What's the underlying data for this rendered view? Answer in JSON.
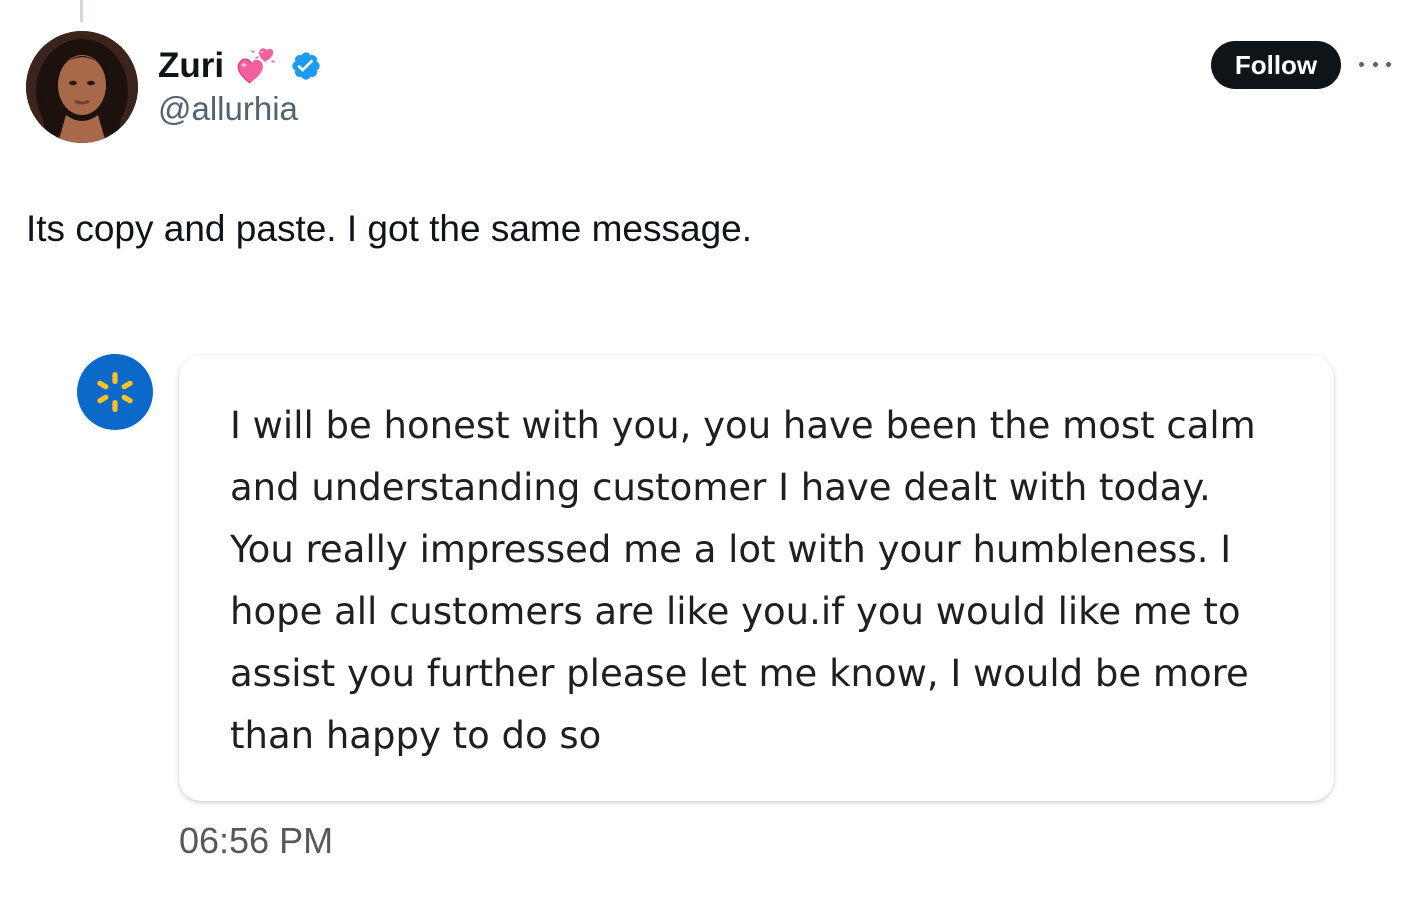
{
  "tweet": {
    "display_name": "Zuri",
    "handle": "@allurhia",
    "follow_label": "Follow",
    "text": "Its copy and paste. I got the same message.",
    "colors": {
      "follow_bg": "#0f1419",
      "verified": "#1d9bf0",
      "handle": "#536471"
    },
    "icons": {
      "name_emoji": "two-hearts-icon",
      "verified": "verified-badge-icon",
      "more": "more-options-icon"
    }
  },
  "chat": {
    "logo": "walmart-spark-logo",
    "logo_color": "#0b6ac9",
    "spark_color": "#ffc220",
    "message_lines": [
      "I will be honest with you, you have been the most calm",
      "and understanding customer I have dealt with today.",
      "You really impressed me a lot with your humbleness. I",
      "hope all customers are like you.if you would like me to",
      "assist you further please let me know, I would be more",
      "than happy to do so"
    ],
    "timestamp": "06:56 PM"
  }
}
